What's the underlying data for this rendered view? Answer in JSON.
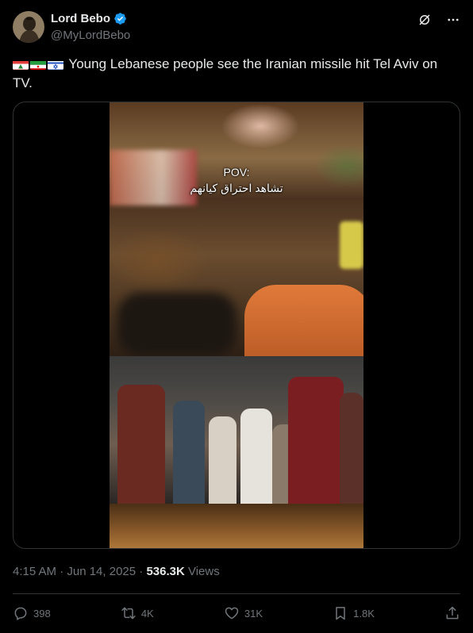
{
  "author": {
    "name": "Lord Bebo",
    "handle": "@MyLordBebo",
    "verified": true,
    "verified_color": "#1d9bf0"
  },
  "header_icons": [
    "grok-icon",
    "more-icon"
  ],
  "tweet": {
    "flags": [
      "lebanon-flag-icon",
      "iran-flag-icon",
      "israel-flag-icon"
    ],
    "text": "Young Lebanese people see the Iranian missile hit Tel Aviv on TV."
  },
  "media": {
    "caption_line1": "POV:",
    "caption_line2": "تشاهد احتراق كيانهم"
  },
  "meta": {
    "timestamp": "4:15 AM · Jun 14, 2025",
    "separator": " · ",
    "views_count": "536.3K",
    "views_label": " Views"
  },
  "actions": {
    "replies": "398",
    "reposts": "4K",
    "likes": "31K",
    "bookmarks": "1.8K"
  },
  "colors": {
    "background": "#000000",
    "text": "#e7e9ea",
    "secondary": "#71767b",
    "border": "#2f3336"
  }
}
